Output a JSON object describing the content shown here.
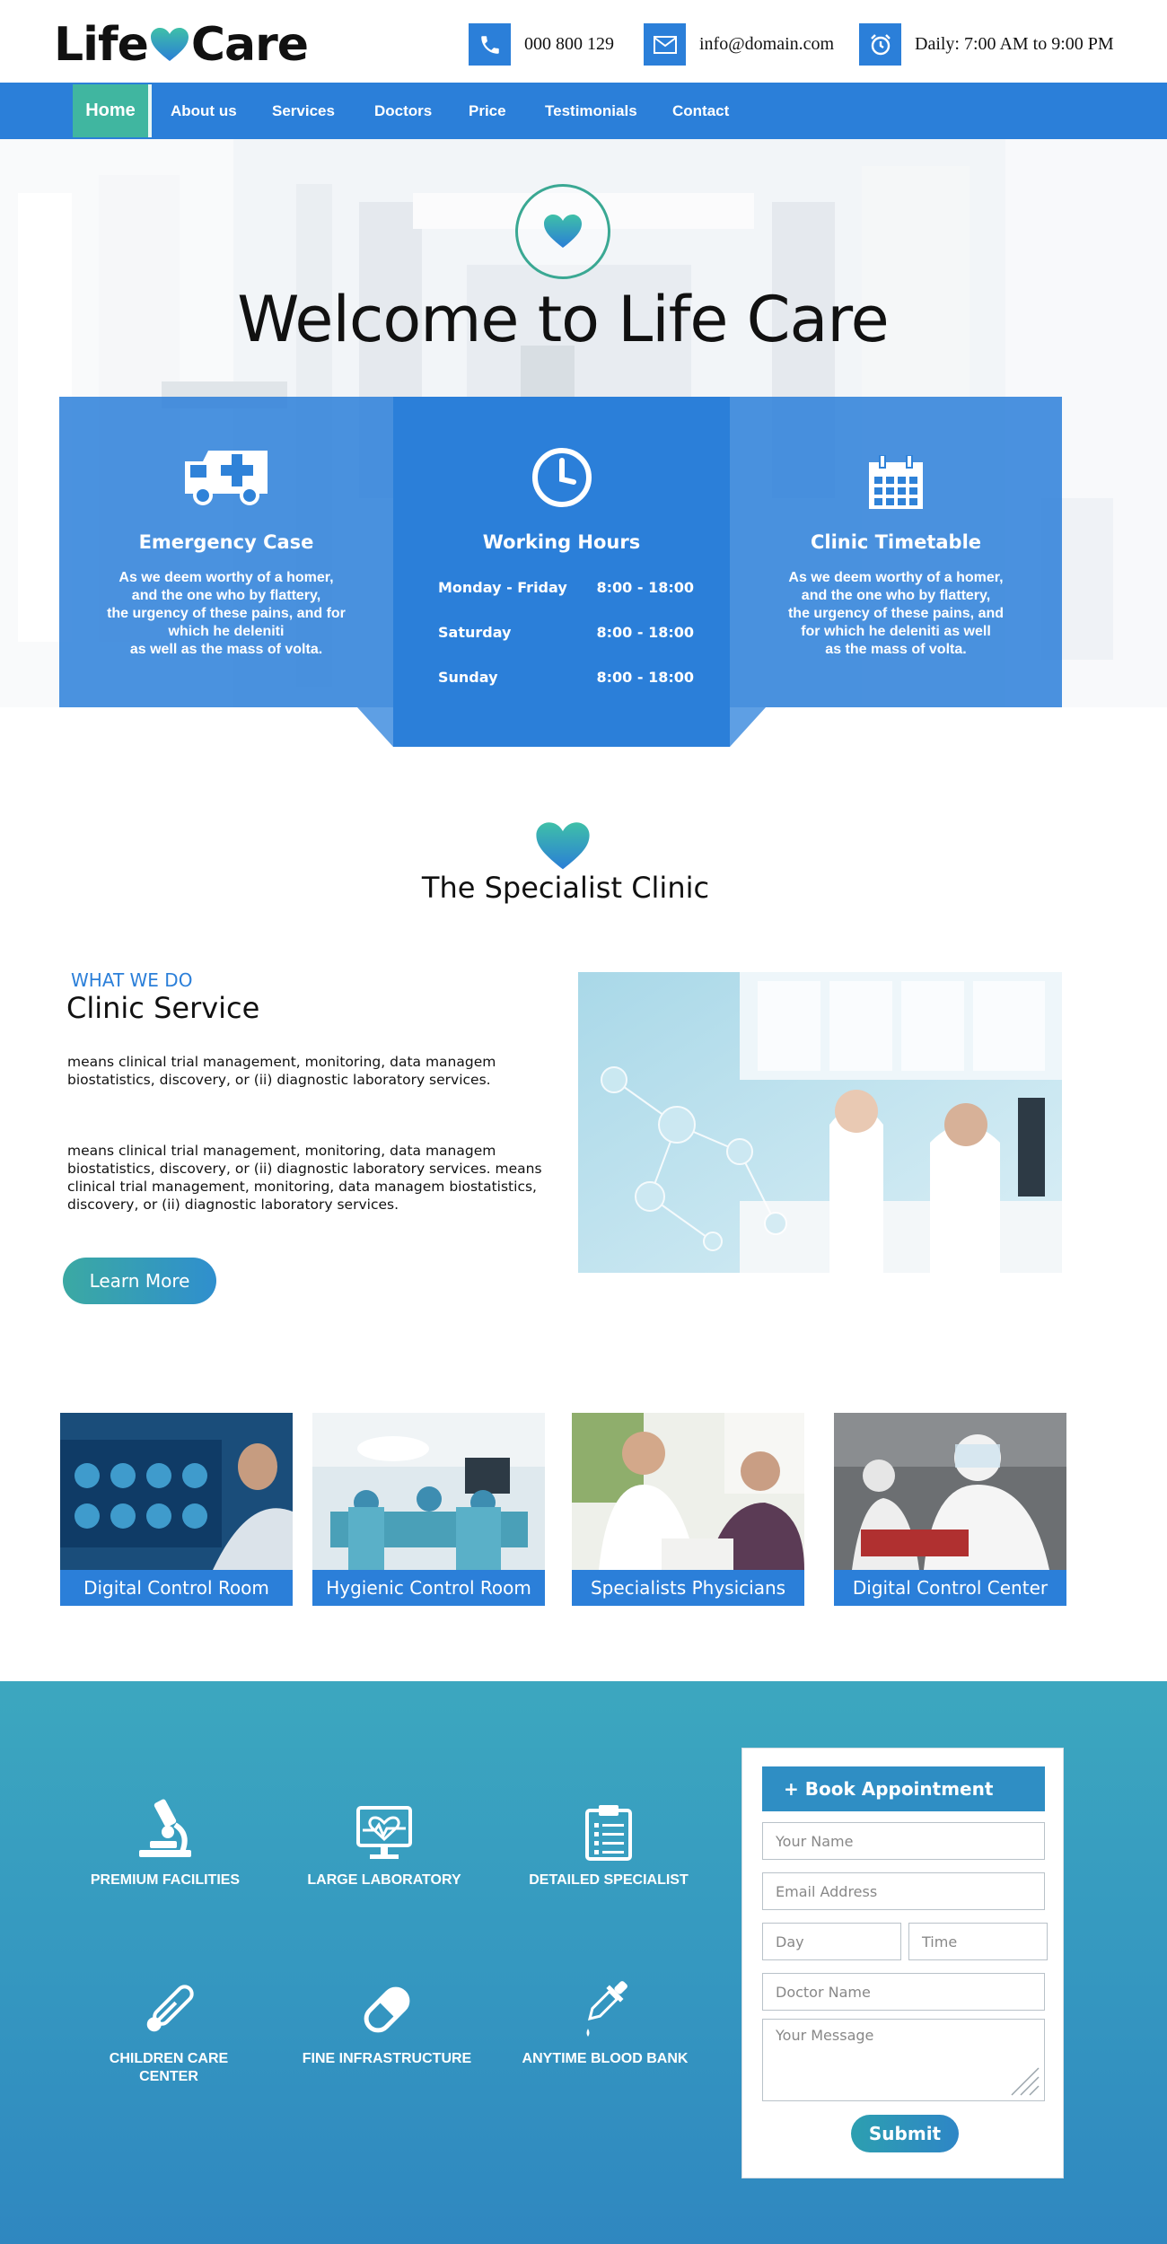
{
  "header": {
    "logo_left": "Life",
    "logo_right": "Care",
    "phone": "000 800 129",
    "email": "info@domain.com",
    "hours": "Daily: 7:00 AM to 9:00 PM",
    "icons": [
      "phone-icon",
      "envelope-icon",
      "alarm-clock-icon"
    ]
  },
  "nav": {
    "items": [
      "Home",
      "About us",
      "Services",
      "Doctors",
      "Price",
      "Testimonials",
      "Contact"
    ],
    "active": "Home"
  },
  "hero": {
    "title": "Welcome to Life Care"
  },
  "panels": {
    "emergency": {
      "title": "Emergency Case",
      "text": "As we deem worthy of a homer,\nand the one who by flattery,\nthe urgency of these pains, and for\nwhich he deleniti\nas well as the mass of volta."
    },
    "hours": {
      "title": "Working Hours",
      "rows": [
        {
          "day": "Monday  -  Friday",
          "time": "8:00  -  18:00"
        },
        {
          "day": "Saturday",
          "time": "8:00  -  18:00"
        },
        {
          "day": "Sunday",
          "time": "8:00  -  18:00"
        }
      ]
    },
    "timetable": {
      "title": "Clinic Timetable",
      "text": "As we deem worthy of a homer,\nand the one who by flattery,\nthe urgency of these pains, and\nfor which he deleniti as well\nas the mass of volta."
    }
  },
  "specialist": {
    "title": "The Specialist Clinic",
    "kicker": "WHAT WE DO",
    "heading": "Clinic Service",
    "para1": "means clinical trial management, monitoring, data managem biostatistics, discovery, or (ii) diagnostic laboratory services.",
    "para2": "means clinical trial management, monitoring, data managem biostatistics, discovery, or (ii) diagnostic laboratory services. means clinical trial management, monitoring, data managem biostatistics, discovery, or (ii) diagnostic laboratory services.",
    "button": "Learn More"
  },
  "cards": [
    {
      "label": "Digital Control Room"
    },
    {
      "label": "Hygienic Control Room"
    },
    {
      "label": "Specialists Physicians"
    },
    {
      "label": "Digital Control Center"
    }
  ],
  "features": [
    {
      "label": "PREMIUM FACILITIES",
      "icon": "microscope-icon"
    },
    {
      "label": "LARGE LABORATORY",
      "icon": "monitor-heartbeat-icon"
    },
    {
      "label": "DETAILED  SPECIALIST",
      "icon": "clipboard-icon"
    },
    {
      "label": "CHILDREN CARE\nCENTER",
      "icon": "thermometer-icon"
    },
    {
      "label": "FINE INFRASTRUCTURE",
      "icon": "pill-icon"
    },
    {
      "label": "ANYTIME BLOOD BANK",
      "icon": "dropper-icon"
    }
  ],
  "appointment": {
    "title": "+ Book Appointment",
    "name_placeholder": "Your Name",
    "email_placeholder": "Email Address",
    "day_placeholder": "Day",
    "time_placeholder": "Time",
    "doctor_placeholder": "Doctor Name",
    "message_placeholder": "Your Message",
    "submit": "Submit"
  },
  "colors": {
    "primary": "#2b7fd9",
    "accent": "#40b6a0",
    "feature_bg": "#3598c0"
  }
}
